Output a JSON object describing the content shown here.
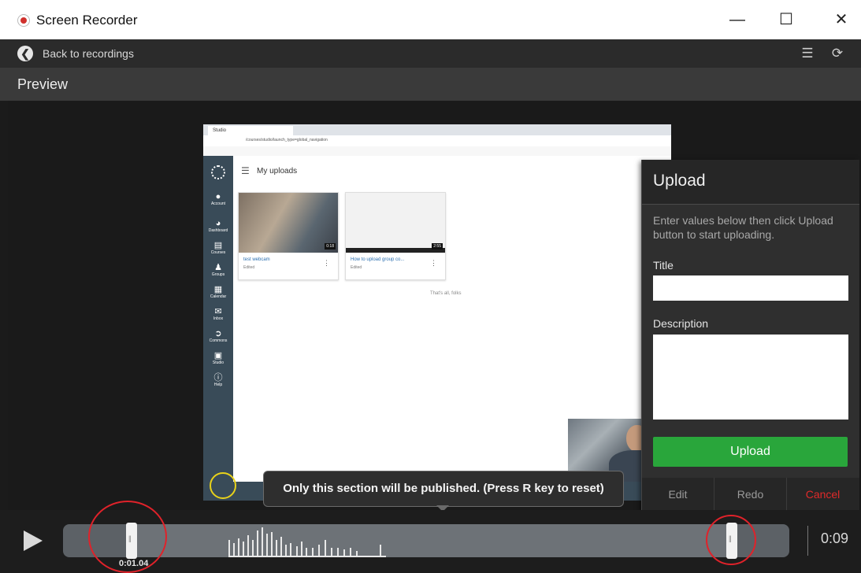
{
  "window": {
    "title": "Screen Recorder",
    "minimize": "—",
    "maximize": "☐",
    "close": "✕"
  },
  "toolbar": {
    "back_label": "Back to recordings"
  },
  "preview": {
    "label": "Preview"
  },
  "browser": {
    "tab_title": "Studio",
    "url": "/courses/studio/launch_type=global_navigation",
    "page_title": "My uploads",
    "nav_items": [
      "Account",
      "Dashboard",
      "Courses",
      "Groups",
      "Calendar",
      "Inbox",
      "Commons",
      "Studio",
      "Help"
    ],
    "videos": [
      {
        "caption": "test webcam",
        "sub": "Edited",
        "duration": "0:18"
      },
      {
        "caption": "How to upload group co...",
        "sub": "Edited",
        "duration": "2:55"
      }
    ],
    "thats_all": "That's all, folks"
  },
  "upload": {
    "title": "Upload",
    "description": "Enter values below then click Upload button to start uploading.",
    "title_label": "Title",
    "title_value": "",
    "description_label": "Description",
    "description_value": "",
    "upload_button": "Upload",
    "edit_button": "Edit",
    "redo_button": "Redo",
    "cancel_button": "Cancel",
    "cancel_color": "#e02a2a",
    "upload_color": "#29a63b"
  },
  "tooltip": {
    "text": "Only this section will be published. (Press R key to reset)"
  },
  "timeline": {
    "start_time": "0:01.04",
    "end_time": "0:09"
  }
}
